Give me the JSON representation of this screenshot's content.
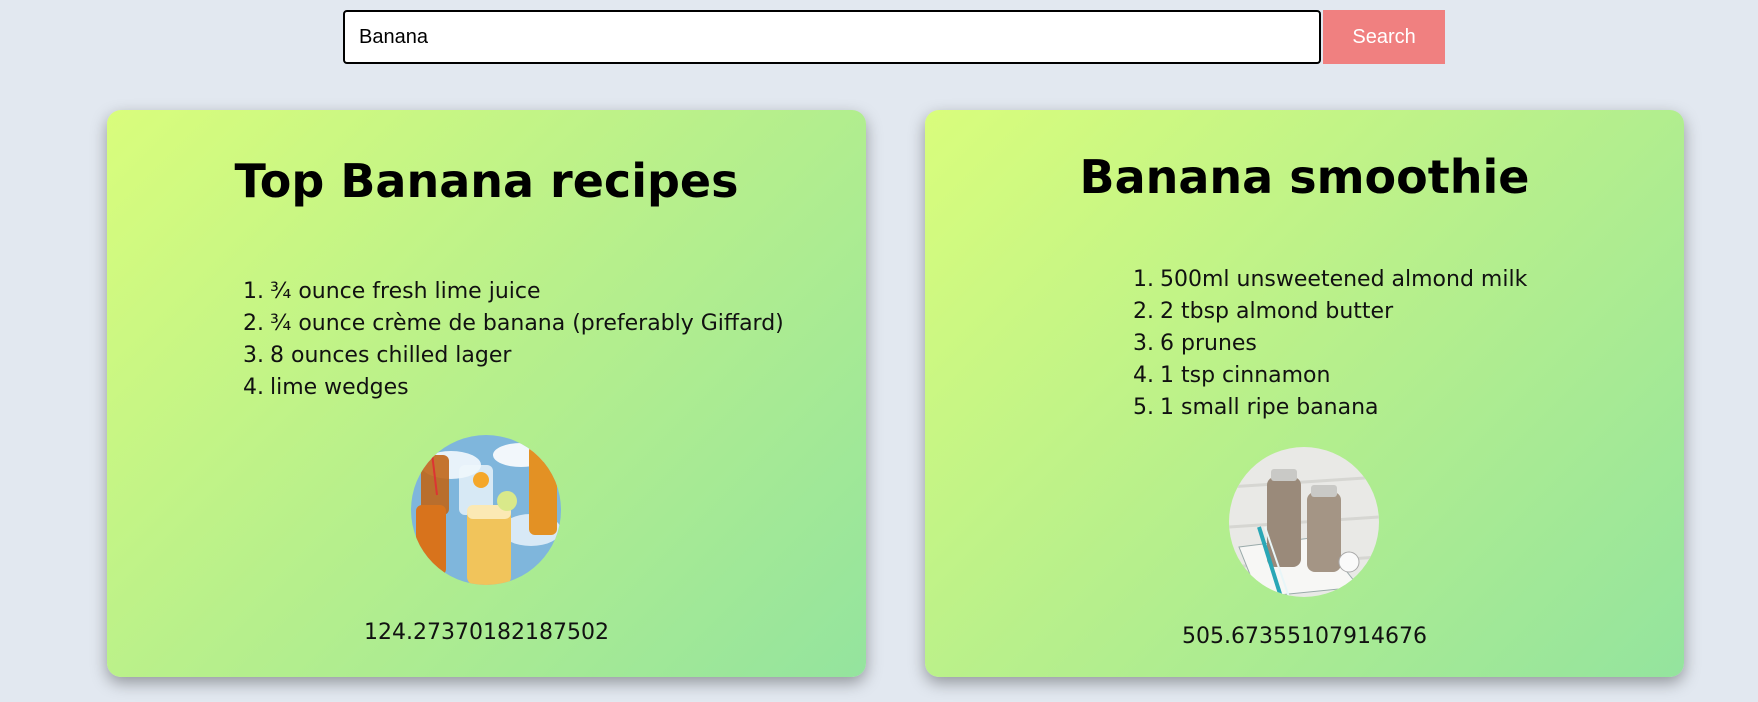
{
  "search": {
    "value": "Banana",
    "button_label": "Search"
  },
  "cards": [
    {
      "title": "Top Banana recipes",
      "ingredients": [
        {
          "num": "1.",
          "text": "¾ ounce fresh lime juice"
        },
        {
          "num": "2.",
          "text": "¾ ounce crème de banana (preferably Giffard)"
        },
        {
          "num": "3.",
          "text": "8 ounces chilled lager"
        },
        {
          "num": "4.",
          "text": "lime wedges"
        }
      ],
      "image": "drinks-photo",
      "value": "124.27370182187502"
    },
    {
      "title": "Banana smoothie",
      "ingredients": [
        {
          "num": "1.",
          "text": "500ml unsweetened almond milk"
        },
        {
          "num": "2.",
          "text": "2 tbsp almond butter"
        },
        {
          "num": "3.",
          "text": "6 prunes"
        },
        {
          "num": "4.",
          "text": "1 tsp cinnamon"
        },
        {
          "num": "5.",
          "text": "1 small ripe banana"
        }
      ],
      "image": "smoothie-bottles-photo",
      "value": "505.67355107914676"
    }
  ],
  "colors": {
    "page_bg": "#e2e8f0",
    "search_button": "#f08080",
    "card_gradient_start": "#d9fd7c",
    "card_gradient_end": "#94e49e"
  }
}
